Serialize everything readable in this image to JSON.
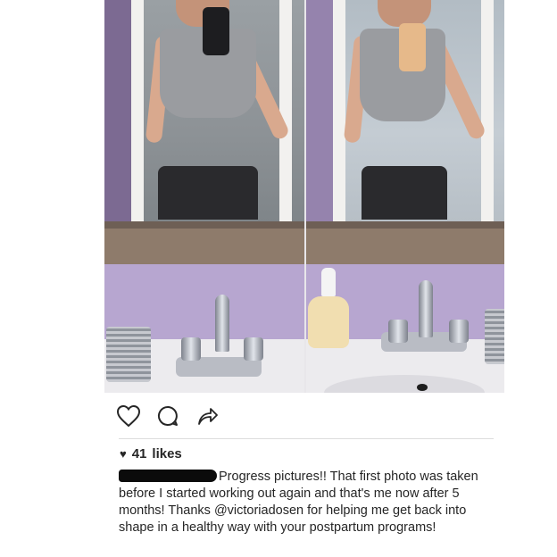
{
  "post": {
    "likes_count": "41",
    "likes_label": "likes",
    "caption": {
      "text_before_mention": "Progress pictures!! That first photo was taken before I started working out again and that's me now after 5 months! Thanks ",
      "mention": "@victoriadosen",
      "text_after_mention": " for helping me get back into shape in a healthy way with your postpartum programs!"
    }
  },
  "actions": {
    "like_icon": "heart-outline-icon",
    "comment_icon": "comment-bubble-icon",
    "share_icon": "share-arrow-icon"
  },
  "colors": {
    "text": "#262626",
    "mention": "#262626",
    "redaction": "#0b0b0b"
  }
}
